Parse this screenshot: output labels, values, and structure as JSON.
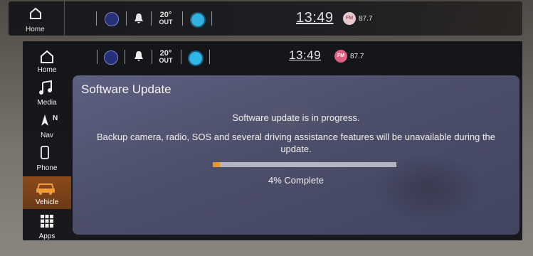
{
  "reflection": {
    "home_label": "Home",
    "temp": {
      "value": "20°",
      "unit": "OUT"
    },
    "time": "13:49",
    "radio": {
      "band": "FM",
      "frequency": "87.7"
    }
  },
  "status_bar": {
    "temp": {
      "value": "20°",
      "unit": "OUT"
    },
    "time": "13:49",
    "radio": {
      "band": "FM",
      "frequency": "87.7"
    }
  },
  "sidebar": {
    "items": [
      {
        "label": "Home",
        "icon": "home-icon"
      },
      {
        "label": "Media",
        "icon": "music-note-icon"
      },
      {
        "label": "Nav",
        "icon": "navigation-arrow-icon",
        "heading": "N"
      },
      {
        "label": "Phone",
        "icon": "phone-icon"
      },
      {
        "label": "Vehicle",
        "icon": "car-icon",
        "active": true
      },
      {
        "label": "Apps",
        "icon": "apps-grid-icon"
      }
    ]
  },
  "dialog": {
    "title": "Software Update",
    "message_primary": "Software update is in progress.",
    "message_secondary": "Backup camera, radio, SOS and several driving assistance features will be unavailable during the update.",
    "progress_fraction": 0.04,
    "progress_text": "4% Complete"
  },
  "colors": {
    "accent": "#e8962e",
    "dialog_bg": "#4c4f6a",
    "active_nav": "#8a4a1a",
    "screen_bg": "#141619"
  }
}
